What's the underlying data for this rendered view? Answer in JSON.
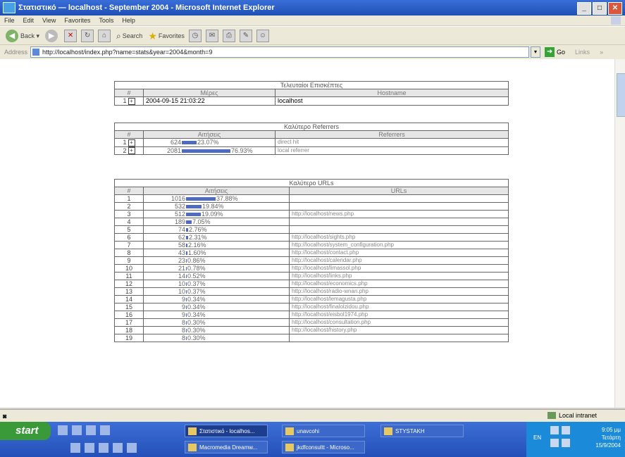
{
  "window": {
    "title": "Στατιστικό — localhost - September 2004 - Microsoft Internet Explorer"
  },
  "menu": [
    "File",
    "Edit",
    "View",
    "Favorites",
    "Tools",
    "Help"
  ],
  "toolbar": {
    "back": "Back",
    "search": "Search",
    "favorites": "Favorites"
  },
  "address": {
    "label": "Address",
    "url": "http://localhost/index.php?name=stats&year=2004&month=9",
    "go": "Go",
    "links": "Links"
  },
  "visitors": {
    "caption": "Τελευταίοι Επισκέπτες",
    "headers": [
      "#",
      "Μέρες",
      "Hostname"
    ],
    "rows": [
      {
        "n": "1",
        "date": "2004-09-15 21:03:22",
        "host": "localhost"
      }
    ]
  },
  "referrers": {
    "caption": "Καλύτερο Referrers",
    "headers": [
      "#",
      "Αιτήσεις",
      "Referrers"
    ],
    "rows": [
      {
        "n": "1",
        "hits": "624",
        "pct": "23.07%",
        "frac": 0.2307,
        "ref": "direct hit"
      },
      {
        "n": "2",
        "hits": "2081",
        "pct": "76.93%",
        "frac": 0.7693,
        "ref": "local referrer"
      }
    ]
  },
  "urls": {
    "caption": "Καλύτερο URLs",
    "headers": [
      "#",
      "Αιτήσεις",
      "URLs"
    ],
    "rows": [
      {
        "n": "1",
        "hits": "1016",
        "pct": "37.88%",
        "frac": 0.3788,
        "url": ""
      },
      {
        "n": "2",
        "hits": "532",
        "pct": "19.84%",
        "frac": 0.1984,
        "url": ""
      },
      {
        "n": "3",
        "hits": "512",
        "pct": "19.09%",
        "frac": 0.1909,
        "url": "http://localhost/news.php"
      },
      {
        "n": "4",
        "hits": "189",
        "pct": "7.05%",
        "frac": 0.0705,
        "url": ""
      },
      {
        "n": "5",
        "hits": "74",
        "pct": "2.76%",
        "frac": 0.0276,
        "url": ""
      },
      {
        "n": "6",
        "hits": "62",
        "pct": "2.31%",
        "frac": 0.0231,
        "url": "http://localhost/sights.php"
      },
      {
        "n": "7",
        "hits": "58",
        "pct": "2.16%",
        "frac": 0.0216,
        "url": "http://localhost/system_configuration.php"
      },
      {
        "n": "8",
        "hits": "43",
        "pct": "1.60%",
        "frac": 0.016,
        "url": "http://localhost/contact.php"
      },
      {
        "n": "9",
        "hits": "23",
        "pct": "0.86%",
        "frac": 0.0086,
        "url": "http://localhost/calendar.php"
      },
      {
        "n": "10",
        "hits": "21",
        "pct": "0.78%",
        "frac": 0.0078,
        "url": "http://localhost/limassol.php"
      },
      {
        "n": "11",
        "hits": "14",
        "pct": "0.52%",
        "frac": 0.0052,
        "url": "http://localhost/links.php"
      },
      {
        "n": "12",
        "hits": "10",
        "pct": "0.37%",
        "frac": 0.0037,
        "url": "http://localhost/economics.php"
      },
      {
        "n": "13",
        "hits": "10",
        "pct": "0.37%",
        "frac": 0.0037,
        "url": "http://localhost/radio-wnan.php"
      },
      {
        "n": "14",
        "hits": "9",
        "pct": "0.34%",
        "frac": 0.0034,
        "url": "http://localhost/lemagusta.php"
      },
      {
        "n": "15",
        "hits": "9",
        "pct": "0.34%",
        "frac": 0.0034,
        "url": "http://localhost/finalolzidou.php"
      },
      {
        "n": "16",
        "hits": "9",
        "pct": "0.34%",
        "frac": 0.0034,
        "url": "http://localhost/eisbol1974.php"
      },
      {
        "n": "17",
        "hits": "8",
        "pct": "0.30%",
        "frac": 0.003,
        "url": "http://localhost/consultation.php"
      },
      {
        "n": "18",
        "hits": "8",
        "pct": "0.30%",
        "frac": 0.003,
        "url": "http://localhost/history.php"
      },
      {
        "n": "19",
        "hits": "8",
        "pct": "0.30%",
        "frac": 0.003,
        "url": ""
      }
    ]
  },
  "status": {
    "zone": "Local intranet"
  },
  "taskbar": {
    "start": "start",
    "tasks": [
      "Στατιστικό - localhos...",
      "unavcohi",
      "STYSTAKH",
      "Macromedia Dreamw...",
      "jkdfconsultt - Microso..."
    ],
    "lang": "EN",
    "clock": [
      "9:05 μμ",
      "Τετάρτη",
      "15/9/2004"
    ]
  }
}
